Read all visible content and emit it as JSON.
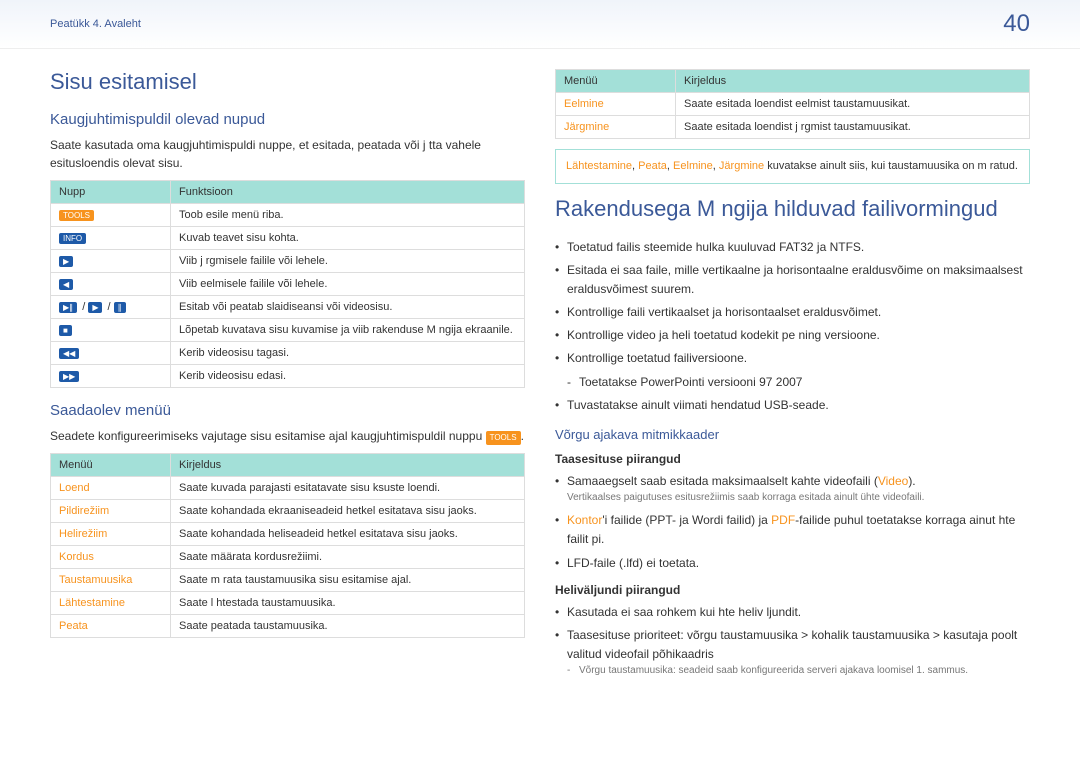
{
  "header": {
    "breadcrumb": "Peatükk 4. Avaleht",
    "page": "40"
  },
  "left": {
    "title": "Sisu esitamisel",
    "sec1": {
      "heading": "Kaugjuhtimispuldil olevad nupud",
      "intro": "Saate kasutada oma kaugjuhtimispuldi nuppe, et esitada, peatada või j tta vahele esitusloendis olevat sisu.",
      "th1": "Nupp",
      "th2": "Funktsioon",
      "rows": [
        {
          "btn": "TOOLS",
          "cls": "orange",
          "desc": "Toob esile menü riba."
        },
        {
          "btn": "INFO",
          "cls": "",
          "desc": "Kuvab teavet sisu kohta."
        },
        {
          "btn": "▶",
          "cls": "",
          "desc": "Viib j rgmisele failile või lehele."
        },
        {
          "btn": "◀",
          "cls": "",
          "desc": "Viib eelmisele failile või lehele."
        },
        {
          "btn": "▶∥ / ▶ / ∥",
          "cls": "",
          "desc": "Esitab või peatab slaidiseansi või videosisu."
        },
        {
          "btn": "■",
          "cls": "",
          "desc": "Lõpetab kuvatava sisu kuvamise ja viib rakenduse M ngija ekraanile."
        },
        {
          "btn": "◀◀",
          "cls": "",
          "desc": "Kerib videosisu tagasi."
        },
        {
          "btn": "▶▶",
          "cls": "",
          "desc": "Kerib videosisu edasi."
        }
      ]
    },
    "sec2": {
      "heading": "Saadaolev menüü",
      "intro_pre": "Seadete konfigureerimiseks vajutage sisu esitamise ajal kaugjuhtimispuldil nuppu ",
      "intro_badge": "TOOLS",
      "intro_post": ".",
      "th1": "Menüü",
      "th2": "Kirjeldus",
      "rows": [
        {
          "m": "Loend",
          "d": "Saate kuvada parajasti esitatavate sisu ksuste loendi."
        },
        {
          "m": "Pildirežiim",
          "d": "Saate kohandada ekraaniseadeid hetkel esitatava sisu jaoks."
        },
        {
          "m": "Helirežiim",
          "d": "Saate kohandada heliseadeid hetkel esitatava sisu jaoks."
        },
        {
          "m": "Kordus",
          "d": "Saate määrata kordusrežiimi."
        },
        {
          "m": "Taustamuusika",
          "d": "Saate m  rata taustamuusika sisu esitamise ajal."
        },
        {
          "m": "Lähtestamine",
          "d": "Saate l htestada taustamuusika."
        },
        {
          "m": "Peata",
          "d": "Saate peatada taustamuusika."
        }
      ]
    }
  },
  "right": {
    "sec1": {
      "th1": "Menüü",
      "th2": "Kirjeldus",
      "rows": [
        {
          "m": "Eelmine",
          "d": "Saate esitada loendist eelmist taustamuusikat."
        },
        {
          "m": "Järgmine",
          "d": "Saate esitada loendist j rgmist taustamuusikat."
        }
      ],
      "note_pre": "",
      "note_items": [
        "Lähtestamine",
        "Peata",
        "Eelmine",
        "Järgmine"
      ],
      "note_post": " kuvatakse ainult siis, kui taustamuusika on m  ratud."
    },
    "sec2": {
      "heading": "Rakendusega M ngija  hilduvad failivormingud",
      "bullets": [
        "Toetatud failis steemide hulka kuuluvad FAT32 ja NTFS.",
        "Esitada ei saa faile, mille vertikaalne ja horisontaalne eraldusvõime on maksimaalsest eraldusvõimest suurem.",
        "Kontrollige faili vertikaalset ja horisontaalset eraldusvõimet.",
        "Kontrollige video ja heli toetatud kodekit  pe ning versioone.",
        "Kontrollige toetatud failiversioone.",
        "Tuvastatakse ainult viimati  hendatud USB-seade."
      ],
      "sub_bullet": "Toetatakse PowerPointi versiooni 97   2007"
    },
    "sec3": {
      "heading": "Võrgu ajakava mitmikkaader",
      "sub1": {
        "title": "Taasesituse piirangud",
        "line1_pre": "Samaaegselt saab esitada maksimaalselt kahte videofaili (",
        "line1_orange": "Video",
        "line1_post": ").",
        "line1b": "Vertikaalses paigutuses esitusrežiimis saab korraga esitada ainult ühte videofaili.",
        "line2_pre": "",
        "line2_orange1": "Kontor",
        "line2_mid": "'i failide (PPT- ja Wordi failid) ja ",
        "line2_orange2": "PDF",
        "line2_post": "-failide puhul toetatakse korraga ainut  hte failit  pi.",
        "line3": "LFD-faile (.lfd) ei toetata."
      },
      "sub2": {
        "title": "Heliväljundi piirangud",
        "line1": "Kasutada ei saa rohkem kui  hte heliv ljundit.",
        "line2": "Taasesituse prioriteet: võrgu taustamuusika > kohalik taustamuusika > kasutaja poolt valitud videofail põhikaadris",
        "sub": "Võrgu taustamuusika: seadeid saab konfigureerida serveri ajakava loomisel 1. sammus."
      }
    }
  }
}
